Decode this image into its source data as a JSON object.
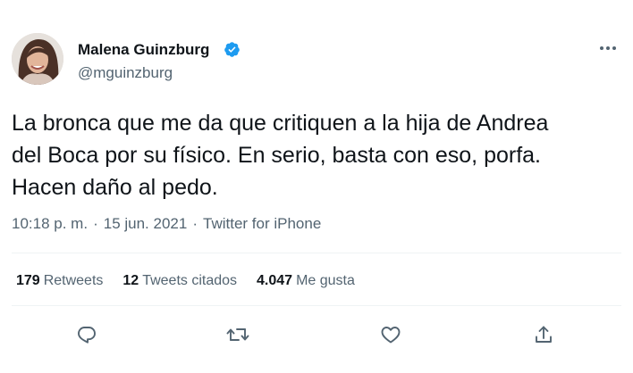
{
  "author": {
    "display_name": "Malena Guinzburg",
    "handle": "@mguinzburg",
    "verified": true
  },
  "tweet": {
    "text": "La bronca que me da que critiquen a la hija de Andrea\ndel Boca por su físico. En serio, basta con eso, porfa.\nHacen daño al pedo.",
    "time": "10:18 p. m.",
    "date": "15 jun. 2021",
    "source": "Twitter for iPhone",
    "separator": "·"
  },
  "stats": {
    "retweets_count": "179",
    "retweets_label": "Retweets",
    "quotes_count": "12",
    "quotes_label": "Tweets citados",
    "likes_count": "4.047",
    "likes_label": "Me gusta"
  },
  "colors": {
    "text": "#0f1419",
    "secondary": "#536471",
    "verified": "#1d9bf0",
    "divider": "#eff3f4"
  },
  "icons": [
    "verified-badge-icon",
    "more-options-icon",
    "reply-icon",
    "retweet-icon",
    "like-icon",
    "share-icon"
  ]
}
